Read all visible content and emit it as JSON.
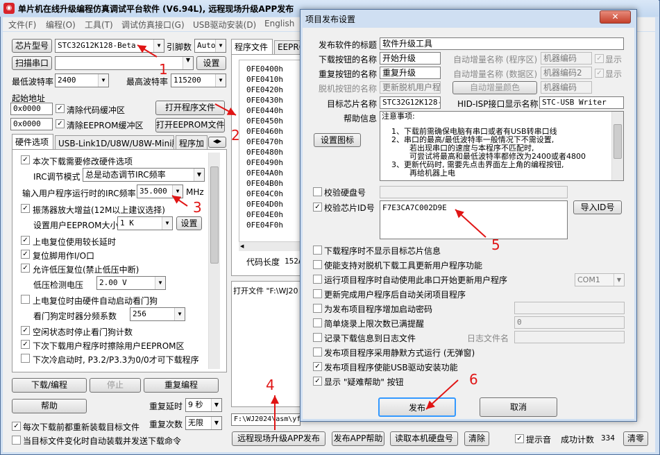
{
  "main": {
    "title": "单片机在线升级编程仿真调试平台软件 (V6.94L), 远程现场升级APP发布",
    "menu": [
      "文件(F)",
      "编程(O)",
      "工具(T)",
      "调试仿真接口(G)",
      "USB驱动安装(D)",
      "English"
    ],
    "chip_btn": "芯片型号",
    "chip_model": "STC32G12K128-Beta",
    "pins_label": "引脚数",
    "pins_value": "Auto",
    "scan_btn": "扫描串口",
    "settings_btn": "设置",
    "min_baud_label": "最低波特率",
    "min_baud": "2400",
    "max_baud_label": "最高波特率",
    "max_baud": "115200",
    "start_addr_label": "起始地址",
    "addr1": "0x0000",
    "clear_code": "清除代码缓冲区",
    "open_prog": "打开程序文件",
    "addr2": "0x0000",
    "clear_eeprom": "清除EEPROM缓冲区",
    "open_eeprom": "打开EEPROM文件",
    "hw_tabs": [
      "硬件选项",
      "USB-Link1D/U8W/U8W-Mini脱机",
      "程序加"
    ],
    "hw_options": {
      "o1": "本次下载需要修改硬件选项",
      "irc_mode_label": "IRC调节模式",
      "irc_mode": "总是动态调节IRC频率",
      "freq_label": "输入用户程序运行时的IRC频率",
      "freq": "35.000",
      "freq_unit": "MHz",
      "o2": "振荡器放大增益(12M以上建议选择)",
      "eeprom_size_label": "设置用户EEPROM大小",
      "eeprom_size": "1  K",
      "eeprom_set": "设置",
      "o3": "上电复位使用较长延时",
      "o4": "复位脚用作I/O口",
      "o5": "允许低压复位(禁止低压中断)",
      "lv_label": "低压检测电压",
      "lv": "2.00 V",
      "o6": "上电复位时由硬件自动启动看门狗",
      "wdt_label": "看门狗定时器分频系数",
      "wdt": "256",
      "o7": "空闲状态时停止看门狗计数",
      "o8": "下次下载用户程序时擦除用户EEPROM区",
      "o9": "下次冷启动时, P3.2/P3.3为0/0才可下载程序"
    },
    "download_btn": "下载/编程",
    "stop_btn": "停止",
    "reprog_btn": "重复编程",
    "help_btn": "帮助",
    "repeat_delay_label": "重复延时",
    "repeat_delay": "9 秒",
    "repeat_count_label": "重复次数",
    "repeat_count": "无限",
    "reload_each": "每次下载前都重新装载目标文件",
    "auto_reload": "当目标文件变化时自动装载并发送下载命令",
    "prog_tabs": [
      "程序文件",
      "EEPROM"
    ],
    "hex_addrs": [
      "0FE0400h",
      "0FE0410h",
      "0FE0420h",
      "0FE0430h",
      "0FE0440h",
      "0FE0450h",
      "0FE0460h",
      "0FE0470h",
      "0FE0480h",
      "0FE0490h",
      "0FE04A0h",
      "0FE04B0h",
      "0FE04C0h",
      "0FE04D0h",
      "0FE04E0h",
      "0FE04F0h"
    ],
    "code_len_label": "代码长度",
    "code_len": "152A",
    "log_text": "打开文件 \"F:\\WJ20",
    "path_text": "F:\\WJ2024\\asm\\yf",
    "bottom_btns": [
      "远程现场升级APP发布",
      "发布APP帮助",
      "读取本机硬盘号",
      "清除"
    ],
    "beep": "提示音",
    "success_label": "成功计数",
    "success_count": "334",
    "clear_count": "清零"
  },
  "dialog": {
    "title": "项目发布设置",
    "close": "✕",
    "pub_title_label": "发布软件的标题",
    "pub_title": "软件升级工具",
    "dl_btn_label": "下载按钮的名称",
    "dl_btn": "开始升级",
    "rp_btn_label": "重复按钮的名称",
    "rp_btn": "重复升级",
    "off_btn_label": "脱机按钮的名称",
    "off_btn": "更新脱机用户程",
    "auto_inc_prog": "自动增量名称 (程序区)",
    "machine_code": "机器编码",
    "show": "显示",
    "auto_inc_data": "自动增量名称 (数据区)",
    "machine_code2": "机器编码2",
    "show2": "显示",
    "auto_inc_color": "自动增量颜色",
    "machine_code3": "机器编码",
    "target_label": "目标芯片名称",
    "target": "STC32G12K128-B",
    "hid_label": "HID-ISP接口显示名称",
    "hid": "STC-USB Writer",
    "help_label": "帮助信息",
    "help_text": [
      "注意事项:",
      "1、下载前需确保电脑有串口或者有USB转串口线",
      "2、串口的最高/最低波特率一般情况下不需设置,",
      "若出现串口的速度与本程序不匹配时,",
      "可尝试将最高和最低波特率都修改为2400或者4800",
      "3、更新代码时, 需要先点击界面左上角的编程按钮,",
      "再给机器上电"
    ],
    "set_icon": "设置图标",
    "verify_disk": "校验硬盘号",
    "verify_chip": "校验芯片ID号",
    "chip_id": "F7E3CA7C002D9E",
    "import_id": "导入ID号",
    "opts": [
      "下载程序时不显示目标芯片信息",
      "使能支持对脱机下载工具更新用户程序功能",
      "运行项目程序时自动使用此串口开始更新用户程序",
      "更新完成用户程序后自动关闭项目程序",
      "为发布项目程序增加启动密码",
      "简单烧录上限次数已满提醒",
      "记录下载信息到日志文件",
      "发布项目程序采用静默方式运行 (无弹窗)",
      "发布项目程序使能USB驱动安装功能",
      "显示 \"疑难帮助\" 按钮"
    ],
    "com_port": "COM1",
    "limit_value": "0",
    "log_name_label": "日志文件名",
    "publish": "发布",
    "cancel": "取消"
  },
  "annotations": [
    "1",
    "2",
    "3",
    "4",
    "5",
    "6"
  ],
  "colors": {
    "annotation": "#e01515",
    "accent": "#3399ff"
  }
}
